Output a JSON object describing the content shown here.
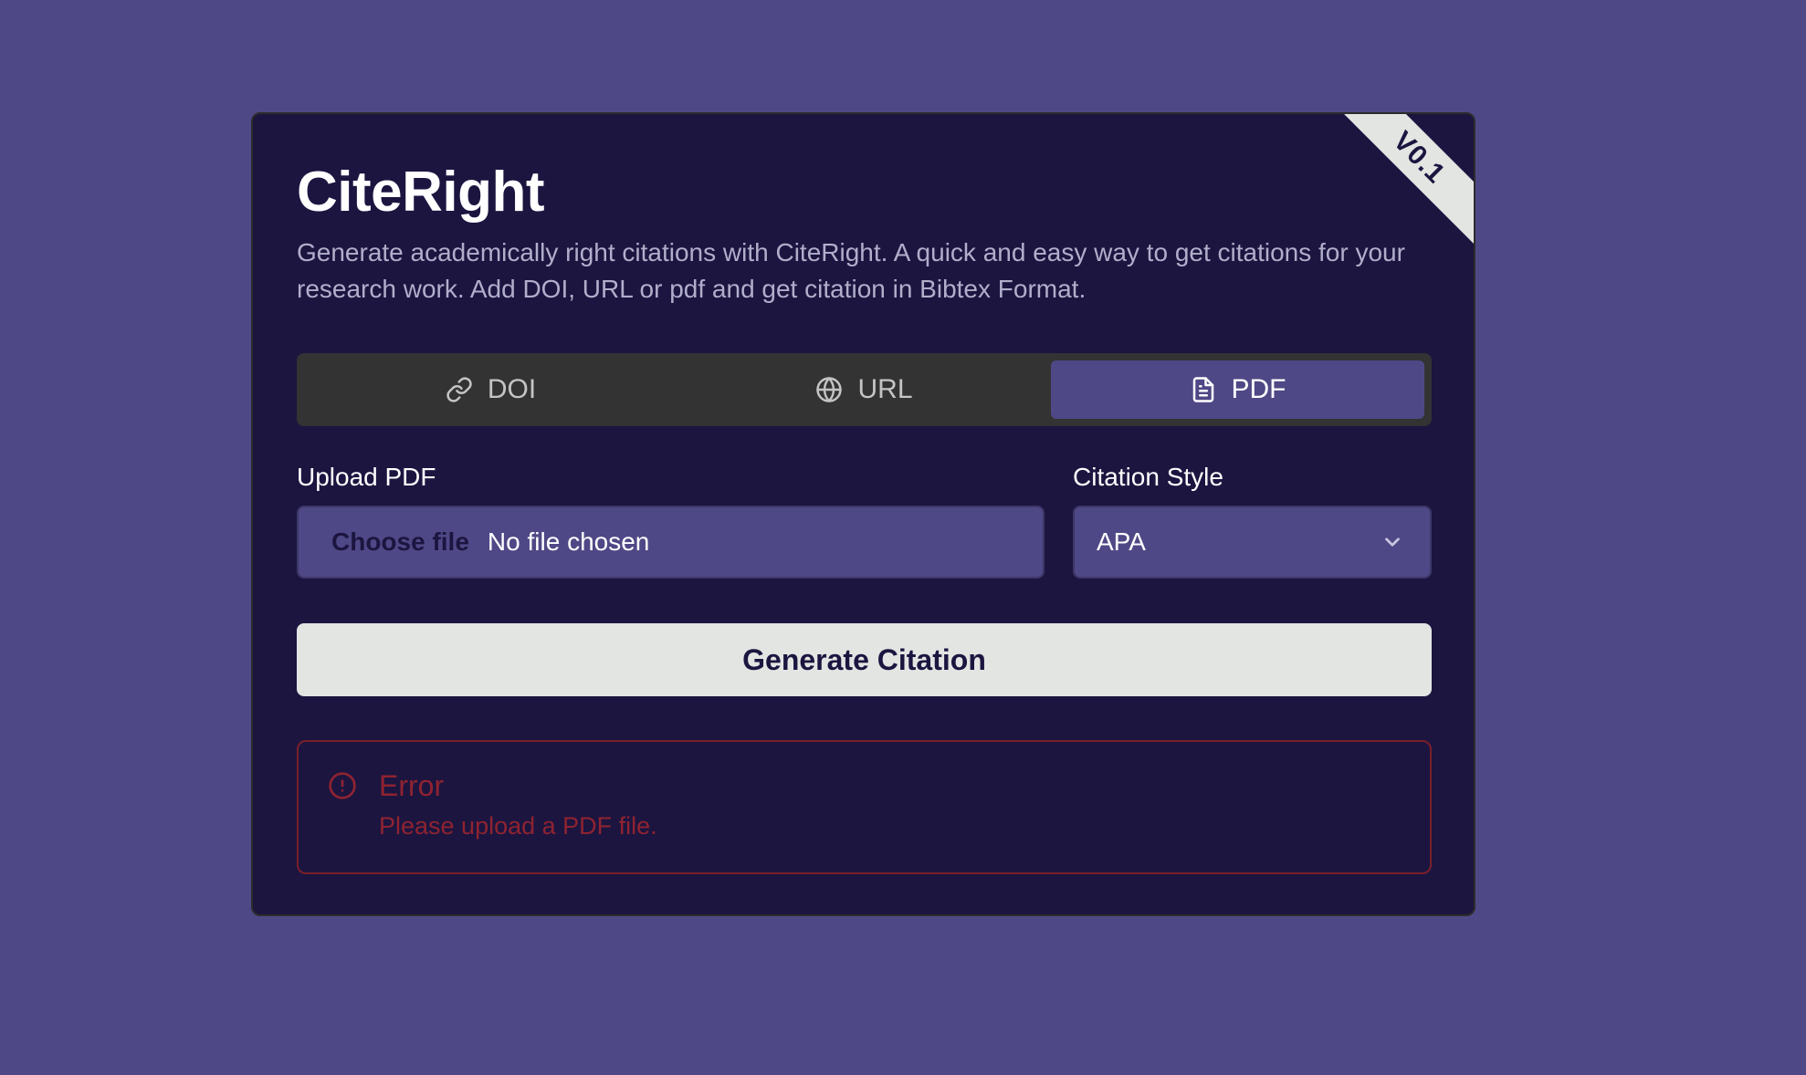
{
  "app": {
    "title": "CiteRight",
    "version": "V0.1",
    "description": "Generate academically right citations with CiteRight. A quick and easy way to get citations for your research work. Add DOI, URL or pdf and get citation in Bibtex Format."
  },
  "tabs": [
    {
      "label": "DOI",
      "icon": "link-icon",
      "active": false
    },
    {
      "label": "URL",
      "icon": "globe-icon",
      "active": false
    },
    {
      "label": "PDF",
      "icon": "file-text-icon",
      "active": true
    }
  ],
  "upload": {
    "label": "Upload PDF",
    "button_label": "Choose file",
    "status": "No file chosen"
  },
  "citation_style": {
    "label": "Citation Style",
    "selected": "APA",
    "icon": "chevron-down-icon"
  },
  "generate_button": {
    "label": "Generate Citation"
  },
  "error": {
    "icon": "alert-circle-icon",
    "title": "Error",
    "message": "Please upload a PDF file."
  },
  "colors": {
    "page_background": "#4f4886",
    "card_background": "#1c1540",
    "accent": "#4f4886",
    "button_background": "#e2e5e2",
    "error": "#8f2330"
  }
}
